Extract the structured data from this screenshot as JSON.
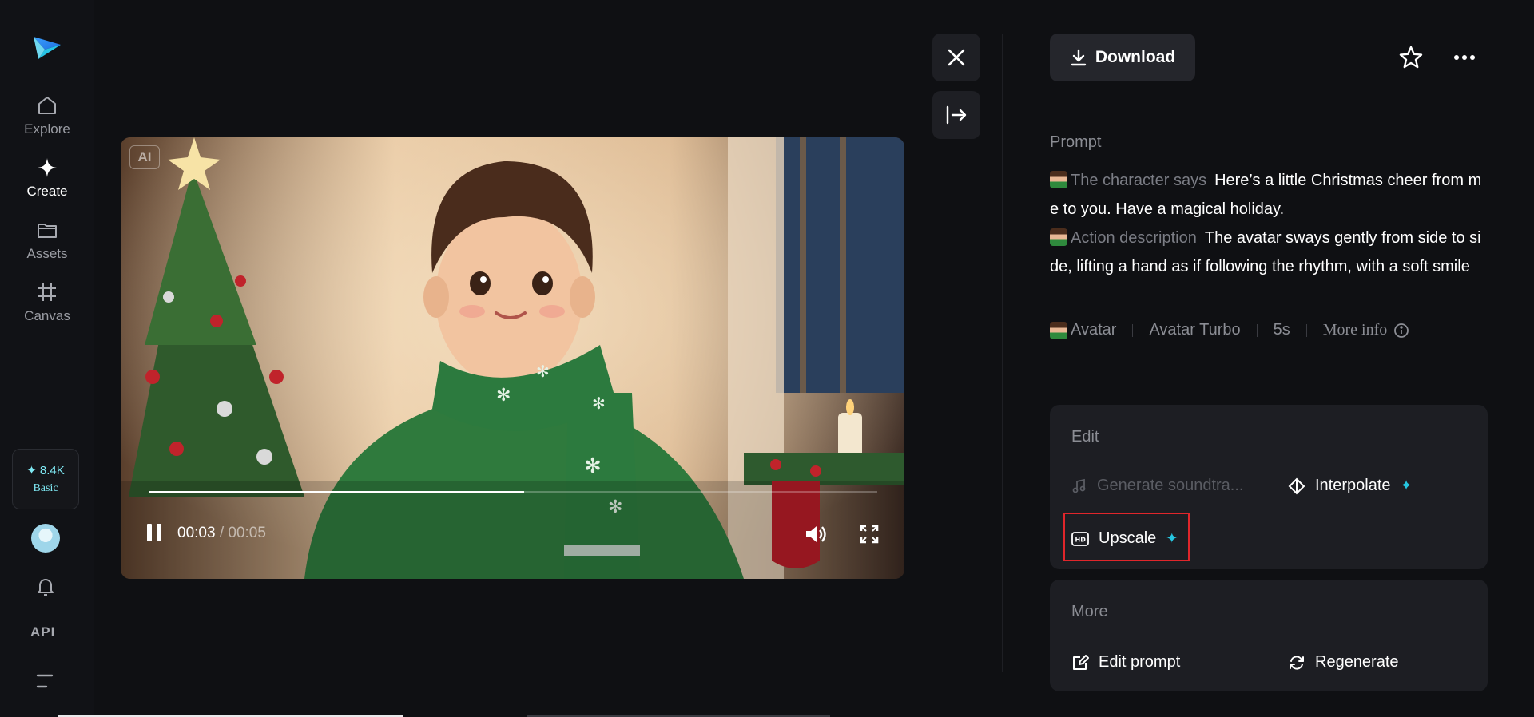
{
  "sidebar": {
    "logo": "app-logo",
    "items": [
      {
        "label": "Explore",
        "icon": "home-icon",
        "active": false
      },
      {
        "label": "Create",
        "icon": "sparkle-icon",
        "active": true
      },
      {
        "label": "Assets",
        "icon": "folder-icon",
        "active": false
      },
      {
        "label": "Canvas",
        "icon": "canvas-icon",
        "active": false
      }
    ],
    "credits": {
      "amount": "8.4K",
      "plan": "Basic"
    },
    "api_label": "API"
  },
  "video": {
    "ai_badge": "AI",
    "current_time": "00:03",
    "separator": " / ",
    "duration": "00:05",
    "progress_fraction": 0.515,
    "playing": true
  },
  "toolbar": {
    "download_label": "Download"
  },
  "prompt": {
    "title": "Prompt",
    "segments": [
      {
        "label": "The character says",
        "text": "Here’s a little Christmas cheer from me to you. Have a magical holiday."
      },
      {
        "label": "Action description",
        "text": "The avatar sways gently from side to side, lifting a hand as if following the rhythm, with a soft smile"
      }
    ],
    "meta": {
      "type": "Avatar",
      "model": "Avatar Turbo",
      "duration": "5s",
      "more_info": "More info"
    }
  },
  "edit": {
    "title": "Edit",
    "soundtrack": "Generate soundtra...",
    "interpolate": "Interpolate",
    "upscale": "Upscale"
  },
  "more": {
    "title": "More",
    "edit_prompt": "Edit prompt",
    "regenerate": "Regenerate"
  },
  "colors": {
    "background": "#0f1013",
    "card": "#1d1e23",
    "accent": "#26c6e0",
    "highlight": "#e0262b"
  }
}
